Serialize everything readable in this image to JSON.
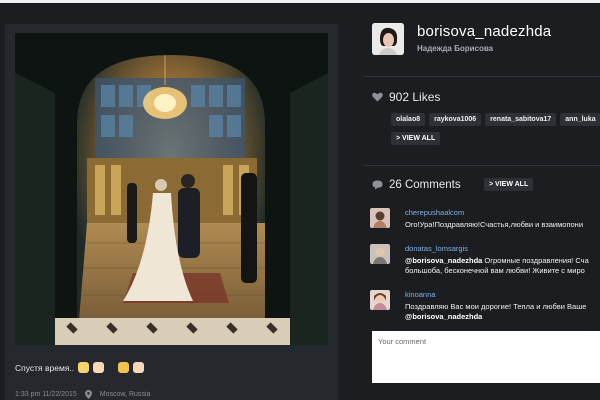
{
  "post": {
    "caption": "Спустя время..",
    "timestamp": "1:33 pm 11/22/2015",
    "location": "Moscow, Russia"
  },
  "profile": {
    "username": "borisova_nadezhda",
    "full_name": "Надежда Борисова"
  },
  "likes": {
    "count_label": "902 Likes",
    "likers": [
      "olalao8",
      "raykova1006",
      "renata_sabitova17",
      "ann_luka"
    ],
    "view_all_label": "> VIEW ALL"
  },
  "comments": {
    "count_label": "26 Comments",
    "view_all_label": "> VIEW ALL",
    "items": [
      {
        "user": "cherepushaalcom",
        "line1": "Ого!Ура!Поздравляю!Счастья,любви и взаимопони"
      },
      {
        "user": "donatas_lomsargis",
        "mention": "@borisova_nadezhda",
        "line1_rest": " Огромные поздравления! Сча",
        "line2": "большоба, бесконечной вам любви! Живите с миро"
      },
      {
        "user": "kinoanna",
        "line1": "Поздравляю Вас мои дорогие! Тепла и любви Ваше",
        "mention": "@borisova_nadezhda"
      }
    ],
    "input_placeholder": "Your comment"
  },
  "icons": {
    "likes": "heart-icon",
    "comments": "speech-bubble-icon",
    "location": "location-pin-icon"
  },
  "colors": {
    "username_link": "#7fb3e8",
    "page_background": "#1b1d20"
  }
}
